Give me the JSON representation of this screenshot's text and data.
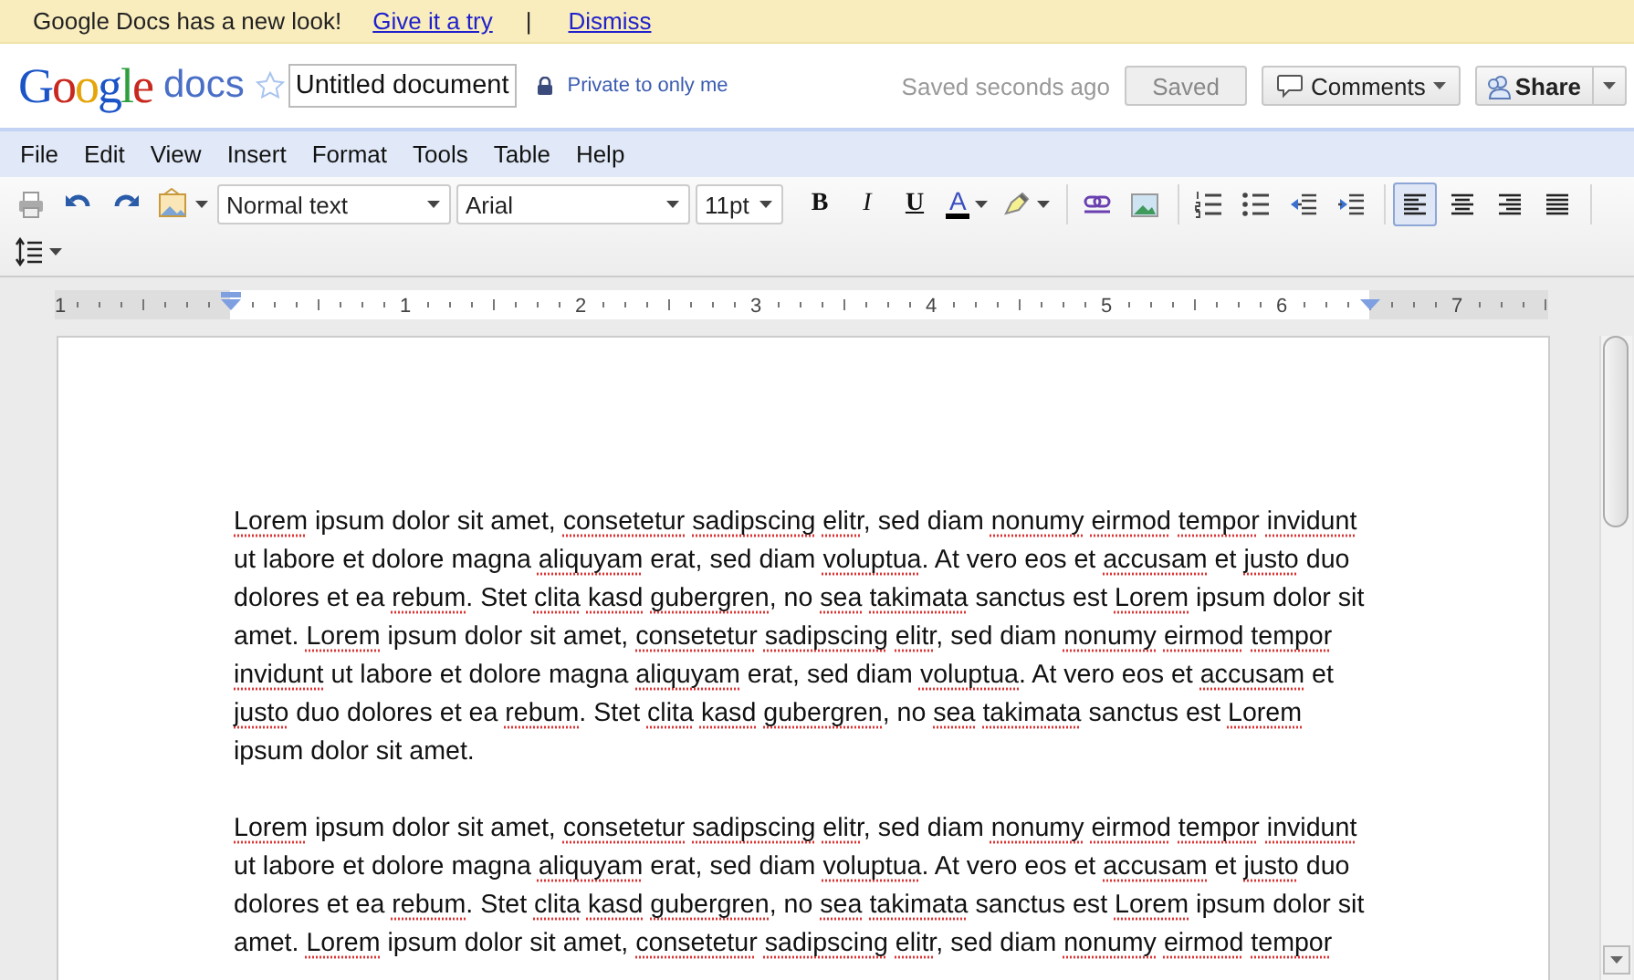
{
  "banner": {
    "message": "Google Docs has a new look!",
    "links": [
      "Give it a try",
      "Dismiss"
    ],
    "separator": "|"
  },
  "header": {
    "logo": "Google",
    "product": "docs",
    "starred": false,
    "title": "Untitled document",
    "privacy": "Private to only me",
    "save_status": "Saved seconds ago",
    "saved_button": {
      "label": "Saved",
      "disabled": true
    },
    "comments_button": "Comments",
    "share_button": "Share"
  },
  "menu": [
    "File",
    "Edit",
    "View",
    "Insert",
    "Format",
    "Tools",
    "Table",
    "Help"
  ],
  "toolbar": {
    "style": "Normal text",
    "font": "Arial",
    "size": "11pt",
    "bold": "B",
    "italic": "I",
    "underline": "U",
    "text_color": "A",
    "alignment": [
      {
        "selected": true
      },
      {
        "selected": false
      },
      {
        "selected": false
      },
      {
        "selected": false
      }
    ]
  },
  "ruler": {
    "labels": [
      "1",
      "1",
      "2",
      "3",
      "4",
      "5",
      "6",
      "7"
    ]
  },
  "document": {
    "paragraphs": [
      {
        "runs": [
          {
            "text": "Lorem",
            "misspelled": true
          },
          {
            "text": " ipsum dolor sit amet, ",
            "misspelled": false
          },
          {
            "text": "consetetur ",
            "misspelled": true
          },
          {
            "text": "sadipscing ",
            "misspelled": true
          },
          {
            "text": "elitr",
            "misspelled": true
          },
          {
            "text": ", sed diam ",
            "misspelled": false
          },
          {
            "text": "nonumy ",
            "misspelled": true
          },
          {
            "text": "eirmod ",
            "misspelled": true
          },
          {
            "text": "tempor ",
            "misspelled": true
          },
          {
            "text": "invidunt",
            "misspelled": true
          },
          {
            "text": " ut labore et dolore magna ",
            "misspelled": false
          },
          {
            "text": "aliquyam",
            "misspelled": true
          },
          {
            "text": " erat, sed diam ",
            "misspelled": false
          },
          {
            "text": "voluptua",
            "misspelled": true
          },
          {
            "text": ". At vero eos et ",
            "misspelled": false
          },
          {
            "text": "accusam",
            "misspelled": true
          },
          {
            "text": " et ",
            "misspelled": false
          },
          {
            "text": "justo",
            "misspelled": true
          },
          {
            "text": " duo dolores et ea ",
            "misspelled": false
          },
          {
            "text": "rebum",
            "misspelled": true
          },
          {
            "text": ". Stet ",
            "misspelled": false
          },
          {
            "text": "clita ",
            "misspelled": true
          },
          {
            "text": "kasd ",
            "misspelled": true
          },
          {
            "text": "gubergren",
            "misspelled": true
          },
          {
            "text": ", no ",
            "misspelled": false
          },
          {
            "text": "sea ",
            "misspelled": true
          },
          {
            "text": "takimata",
            "misspelled": true
          },
          {
            "text": " sanctus est ",
            "misspelled": false
          },
          {
            "text": "Lorem",
            "misspelled": true
          },
          {
            "text": " ipsum dolor sit amet. ",
            "misspelled": false
          },
          {
            "text": "Lorem",
            "misspelled": true
          },
          {
            "text": " ipsum dolor sit amet, ",
            "misspelled": false
          },
          {
            "text": "consetetur ",
            "misspelled": true
          },
          {
            "text": "sadipscing ",
            "misspelled": true
          },
          {
            "text": "elitr",
            "misspelled": true
          },
          {
            "text": ", sed diam ",
            "misspelled": false
          },
          {
            "text": "nonumy ",
            "misspelled": true
          },
          {
            "text": "eirmod ",
            "misspelled": true
          },
          {
            "text": "tempor ",
            "misspelled": true
          },
          {
            "text": "invidunt",
            "misspelled": true
          },
          {
            "text": " ut labore et dolore magna ",
            "misspelled": false
          },
          {
            "text": "aliquyam",
            "misspelled": true
          },
          {
            "text": " erat, sed diam ",
            "misspelled": false
          },
          {
            "text": "voluptua",
            "misspelled": true
          },
          {
            "text": ". At vero eos et ",
            "misspelled": false
          },
          {
            "text": "accusam",
            "misspelled": true
          },
          {
            "text": " et ",
            "misspelled": false
          },
          {
            "text": "justo",
            "misspelled": true
          },
          {
            "text": " duo dolores et ea ",
            "misspelled": false
          },
          {
            "text": "rebum",
            "misspelled": true
          },
          {
            "text": ". Stet ",
            "misspelled": false
          },
          {
            "text": "clita ",
            "misspelled": true
          },
          {
            "text": "kasd ",
            "misspelled": true
          },
          {
            "text": "gubergren",
            "misspelled": true
          },
          {
            "text": ", no ",
            "misspelled": false
          },
          {
            "text": "sea ",
            "misspelled": true
          },
          {
            "text": "takimata",
            "misspelled": true
          },
          {
            "text": " sanctus est ",
            "misspelled": false
          },
          {
            "text": "Lorem",
            "misspelled": true
          },
          {
            "text": " ipsum dolor sit amet.",
            "misspelled": false
          }
        ]
      },
      {
        "runs": [
          {
            "text": "Lorem",
            "misspelled": true
          },
          {
            "text": " ipsum dolor sit amet, ",
            "misspelled": false
          },
          {
            "text": "consetetur ",
            "misspelled": true
          },
          {
            "text": "sadipscing ",
            "misspelled": true
          },
          {
            "text": "elitr",
            "misspelled": true
          },
          {
            "text": ", sed diam ",
            "misspelled": false
          },
          {
            "text": "nonumy ",
            "misspelled": true
          },
          {
            "text": "eirmod ",
            "misspelled": true
          },
          {
            "text": "tempor ",
            "misspelled": true
          },
          {
            "text": "invidunt",
            "misspelled": true
          },
          {
            "text": " ut labore et dolore magna ",
            "misspelled": false
          },
          {
            "text": "aliquyam",
            "misspelled": true
          },
          {
            "text": " erat, sed diam ",
            "misspelled": false
          },
          {
            "text": "voluptua",
            "misspelled": true
          },
          {
            "text": ". At vero eos et ",
            "misspelled": false
          },
          {
            "text": "accusam",
            "misspelled": true
          },
          {
            "text": " et ",
            "misspelled": false
          },
          {
            "text": "justo",
            "misspelled": true
          },
          {
            "text": " duo dolores et ea ",
            "misspelled": false
          },
          {
            "text": "rebum",
            "misspelled": true
          },
          {
            "text": ". Stet ",
            "misspelled": false
          },
          {
            "text": "clita ",
            "misspelled": true
          },
          {
            "text": "kasd ",
            "misspelled": true
          },
          {
            "text": "gubergren",
            "misspelled": true
          },
          {
            "text": ", no ",
            "misspelled": false
          },
          {
            "text": "sea ",
            "misspelled": true
          },
          {
            "text": "takimata",
            "misspelled": true
          },
          {
            "text": " sanctus est ",
            "misspelled": false
          },
          {
            "text": "Lorem",
            "misspelled": true
          },
          {
            "text": " ipsum dolor sit amet. ",
            "misspelled": false
          },
          {
            "text": "Lorem",
            "misspelled": true
          },
          {
            "text": " ipsum dolor sit amet, ",
            "misspelled": false
          },
          {
            "text": "consetetur ",
            "misspelled": true
          },
          {
            "text": "sadipscing ",
            "misspelled": true
          },
          {
            "text": "elitr",
            "misspelled": true
          },
          {
            "text": ", sed diam ",
            "misspelled": false
          },
          {
            "text": "nonumy ",
            "misspelled": true
          },
          {
            "text": "eirmod ",
            "misspelled": true
          },
          {
            "text": "tempor",
            "misspelled": true
          }
        ]
      }
    ]
  }
}
